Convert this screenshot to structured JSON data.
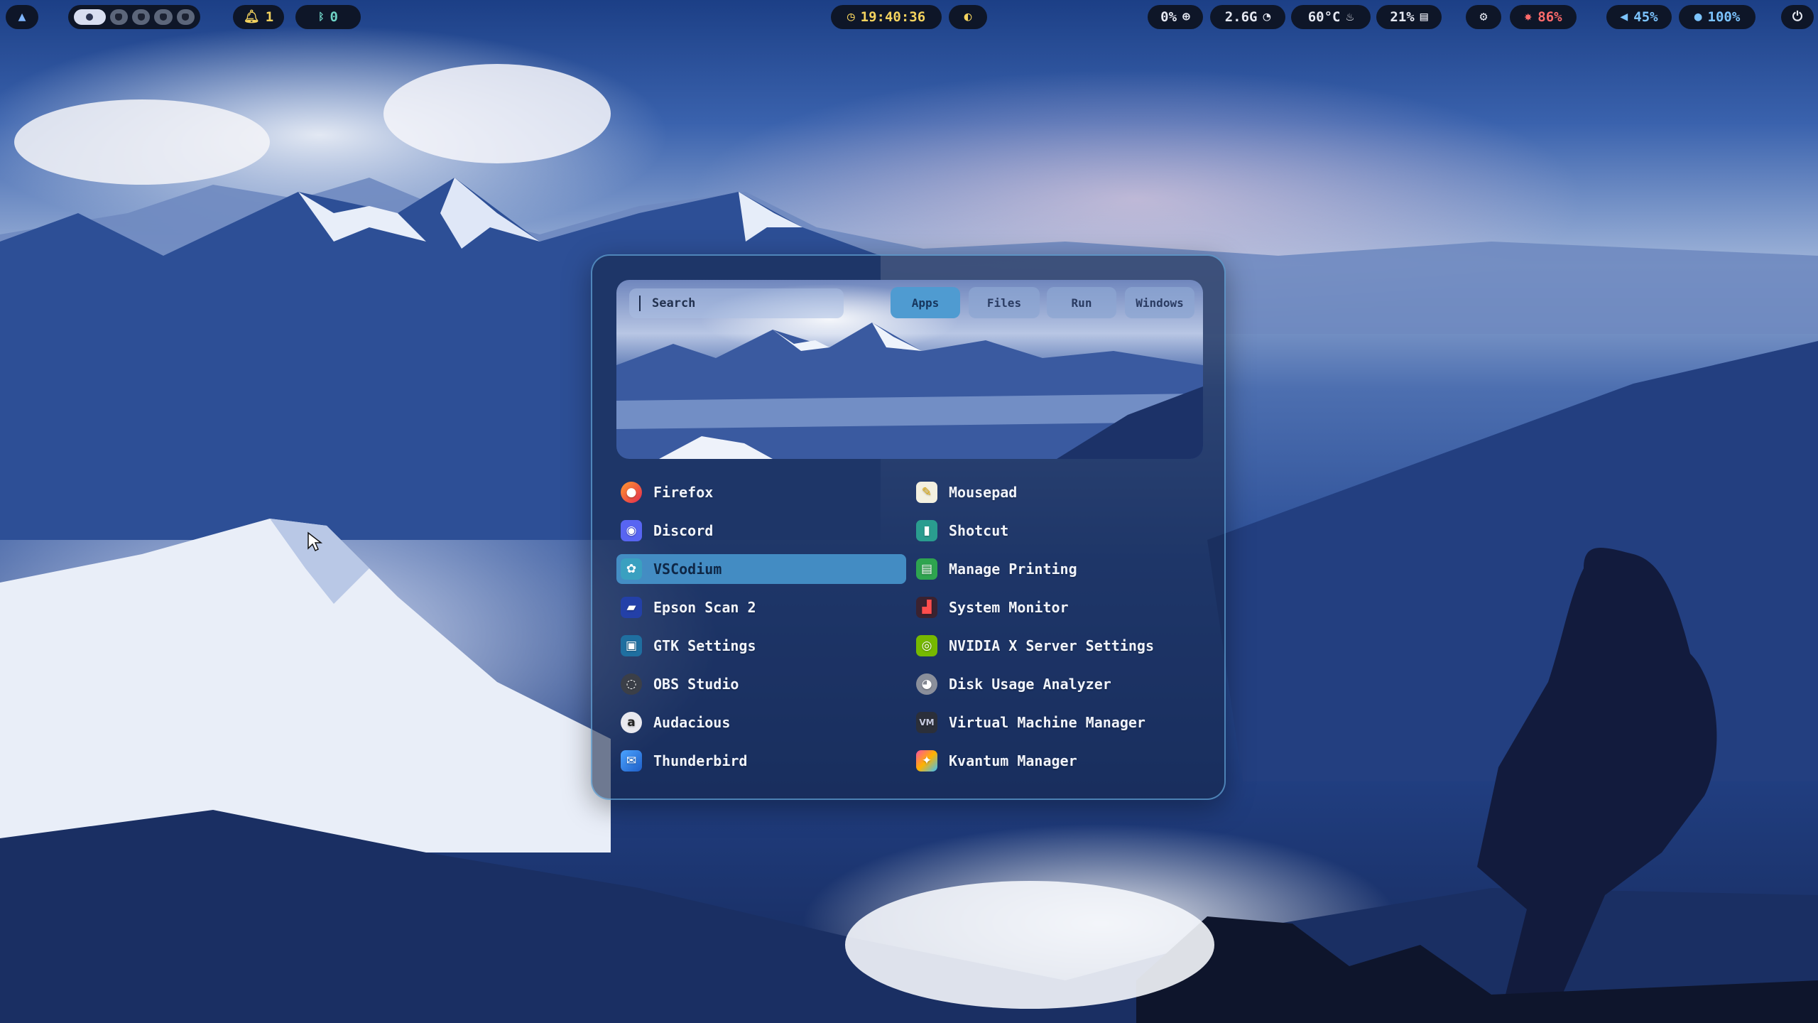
{
  "topbar": {
    "notifications_count": "1",
    "bluetooth_count": "0",
    "clock": "19:40:36",
    "cpu": "0%",
    "memory": "2.6G",
    "temperature": "60°C",
    "disk": "21%",
    "brightness": "86%",
    "volume": "45%",
    "mic": "100%"
  },
  "launcher": {
    "search_placeholder": "Search",
    "tabs": [
      "Apps",
      "Files",
      "Run",
      "Windows"
    ],
    "apps_left": [
      "Firefox",
      "Discord",
      "VSCodium",
      "Epson Scan 2",
      "GTK Settings",
      "OBS Studio",
      "Audacious",
      "Thunderbird"
    ],
    "apps_right": [
      "Mousepad",
      "Shotcut",
      "Manage Printing",
      "System Monitor",
      "NVIDIA X Server Settings",
      "Disk Usage Analyzer",
      "Virtual Machine Manager",
      "Kvantum Manager"
    ],
    "selected_app": "VSCodium"
  },
  "colors": {
    "accent": "#4f9bd1",
    "bar_bg": "#0d1220",
    "brightness_red": "#ff6b6b",
    "mic_blue": "#7cc4ff"
  },
  "icons": {
    "menu": "arch-logo-icon",
    "bell": "bell-icon",
    "bluetooth": "bluetooth-icon",
    "clock": "clock-icon",
    "toggle": "toggle-icon",
    "settings": "gear-icon",
    "power": "power-icon"
  }
}
